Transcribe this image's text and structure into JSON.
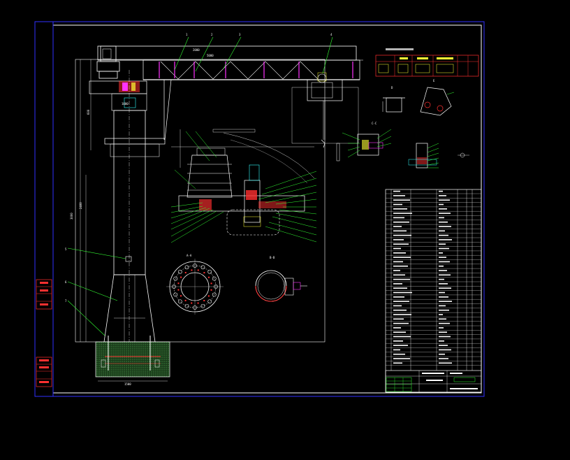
{
  "drawing": {
    "title": "",
    "labels": {
      "section_a": "A-A",
      "section_b": "B-B",
      "section_c": "C-C",
      "view_d": "D",
      "view_e": "E"
    }
  },
  "colors": {
    "background": "#000000",
    "frame": "#2f2fff",
    "outline": "#ffffff",
    "leader": "#33ff33",
    "accent": "#ff33ff",
    "red": "#ff3030",
    "cyan": "#33ffff",
    "yellow": "#ffff33"
  }
}
